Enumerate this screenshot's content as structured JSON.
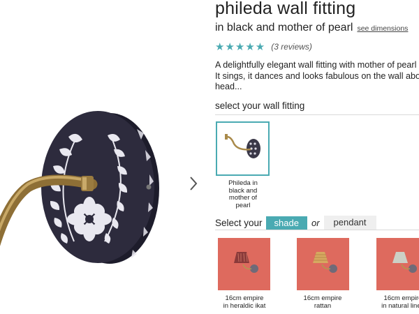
{
  "product": {
    "title": "phileda wall fitting",
    "subtitle": "in black and mother of pearl",
    "see_dimensions": "see dimensions",
    "stars": "★★★★★",
    "reviews": "(3 reviews)",
    "description_lines": [
      "A delightfully elegant wall fitting with mother of pearl inlay.",
      "It sings, it dances and looks fabulous on the wall above your",
      "head..."
    ]
  },
  "fitting_section": {
    "label": "select your wall fitting",
    "selected_item": {
      "lines": [
        "Phileda in",
        "black and",
        "mother of",
        "pearl"
      ]
    }
  },
  "option_selector": {
    "label": "Select your",
    "shade_button": "shade",
    "or_text": "or",
    "pendant_button": "pendant"
  },
  "shades": [
    {
      "line1": "16cm empire",
      "line2": "in heraldic ikat",
      "shade_color": "#8a3a3a",
      "bg_color": "#de6a5e"
    },
    {
      "line1": "16cm empire",
      "line2": "rattan",
      "shade_color": "#d6a860",
      "bg_color": "#de6a5e"
    },
    {
      "line1": "16cm empire",
      "line2": "in natural linen",
      "shade_color": "#ccd0c6",
      "bg_color": "#de6a5e"
    }
  ],
  "colors": {
    "accent": "#4aaab2",
    "plate": "#2d2b3d",
    "inlay": "#e9e8f0",
    "brass": "#a98a4a"
  },
  "icons": {
    "next_arrow": "chevron-right-icon",
    "rating": "star-icon"
  }
}
